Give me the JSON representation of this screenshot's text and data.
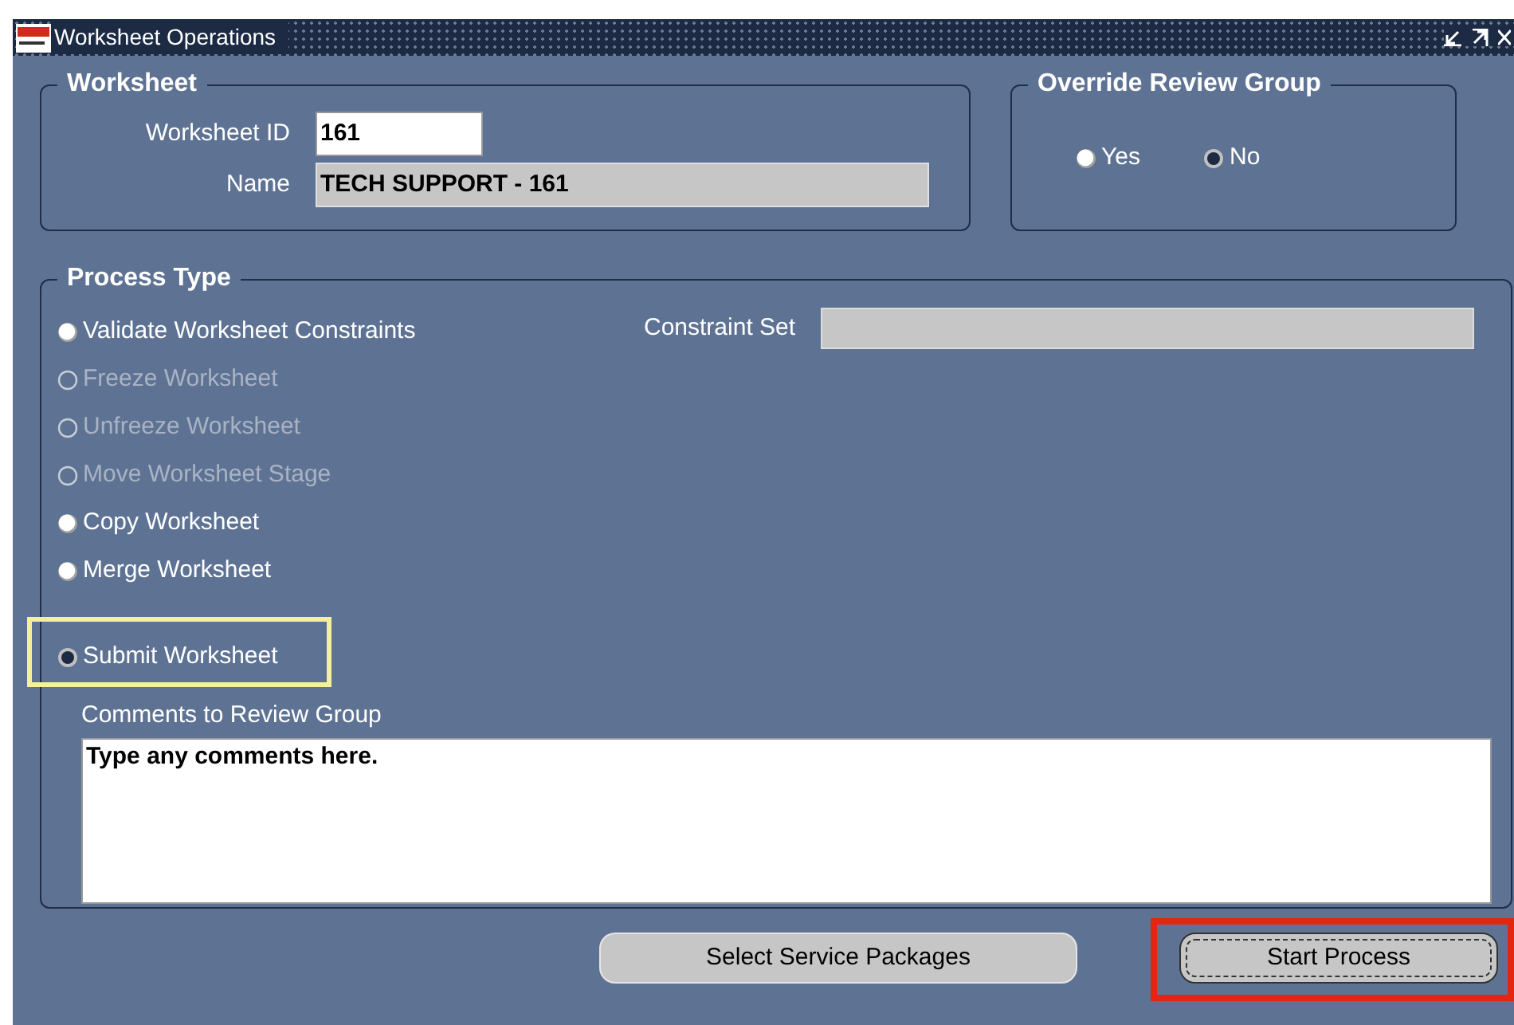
{
  "window": {
    "title": "Worksheet Operations"
  },
  "worksheet": {
    "title": "Worksheet",
    "fields": [
      {
        "label": "Worksheet ID",
        "value": "161",
        "disabled": false
      },
      {
        "label": "Name",
        "value": "TECH SUPPORT - 161",
        "disabled": true
      }
    ]
  },
  "override_review_group": {
    "title": "Override Review Group",
    "options": [
      {
        "label": "Yes",
        "selected": false
      },
      {
        "label": "No",
        "selected": true
      }
    ]
  },
  "process_type": {
    "title": "Process Type",
    "options": [
      {
        "label": "Validate Worksheet Constraints",
        "selected": false,
        "disabled": false
      },
      {
        "label": "Freeze Worksheet",
        "selected": false,
        "disabled": true
      },
      {
        "label": "Unfreeze Worksheet",
        "selected": false,
        "disabled": true
      },
      {
        "label": "Move Worksheet Stage",
        "selected": false,
        "disabled": true
      },
      {
        "label": "Copy Worksheet",
        "selected": false,
        "disabled": false
      },
      {
        "label": "Merge Worksheet",
        "selected": false,
        "disabled": false
      },
      {
        "label": "Submit Worksheet",
        "selected": true,
        "disabled": false,
        "highlighted": true
      }
    ],
    "constraint_set": {
      "label": "Constraint Set"
    },
    "comments": {
      "label": "Comments to Review Group",
      "value": "Type any comments here."
    }
  },
  "buttons": [
    {
      "label": "Select Service Packages",
      "highlighted": false
    },
    {
      "label": "Start Process",
      "highlighted": true
    }
  ]
}
